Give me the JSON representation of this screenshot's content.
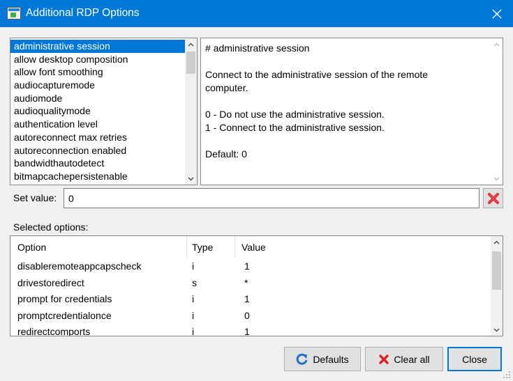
{
  "window": {
    "title": "Additional RDP Options",
    "app_icon": "rdp-app-icon",
    "close_icon": "close-icon"
  },
  "options_list": {
    "selected_index": 0,
    "items": [
      "administrative session",
      "allow desktop composition",
      "allow font smoothing",
      "audiocapturemode",
      "audiomode",
      "audioqualitymode",
      "authentication level",
      "autoreconnect max retries",
      "autoreconnection enabled",
      "bandwidthautodetect",
      "bitmapcachepersistenable"
    ]
  },
  "description": {
    "lines": [
      "# administrative session",
      "",
      "Connect to the administrative session of the remote",
      "computer.",
      "",
      "0 - Do not use the administrative session.",
      "1 - Connect to the administrative session.",
      "",
      "Default: 0"
    ]
  },
  "set_value": {
    "label": "Set value:",
    "value": "0",
    "clear_icon": "red-x-icon"
  },
  "selected_options": {
    "label": "Selected options:",
    "columns": [
      "Option",
      "Type",
      "Value"
    ],
    "rows": [
      [
        "disableremoteappcapscheck",
        "i",
        "1"
      ],
      [
        "drivestoredirect",
        "s",
        "*"
      ],
      [
        "prompt for credentials",
        "i",
        "1"
      ],
      [
        "promptcredentialonce",
        "i",
        "0"
      ],
      [
        "redirectcomports",
        "i",
        "1"
      ]
    ]
  },
  "buttons": {
    "defaults": "Defaults",
    "clear_all": "Clear all",
    "close": "Close"
  },
  "colors": {
    "accent": "#0078d7",
    "selection": "#0078d7",
    "clear_red": "#d9232e",
    "refresh_blue": "#1e6fc8"
  }
}
